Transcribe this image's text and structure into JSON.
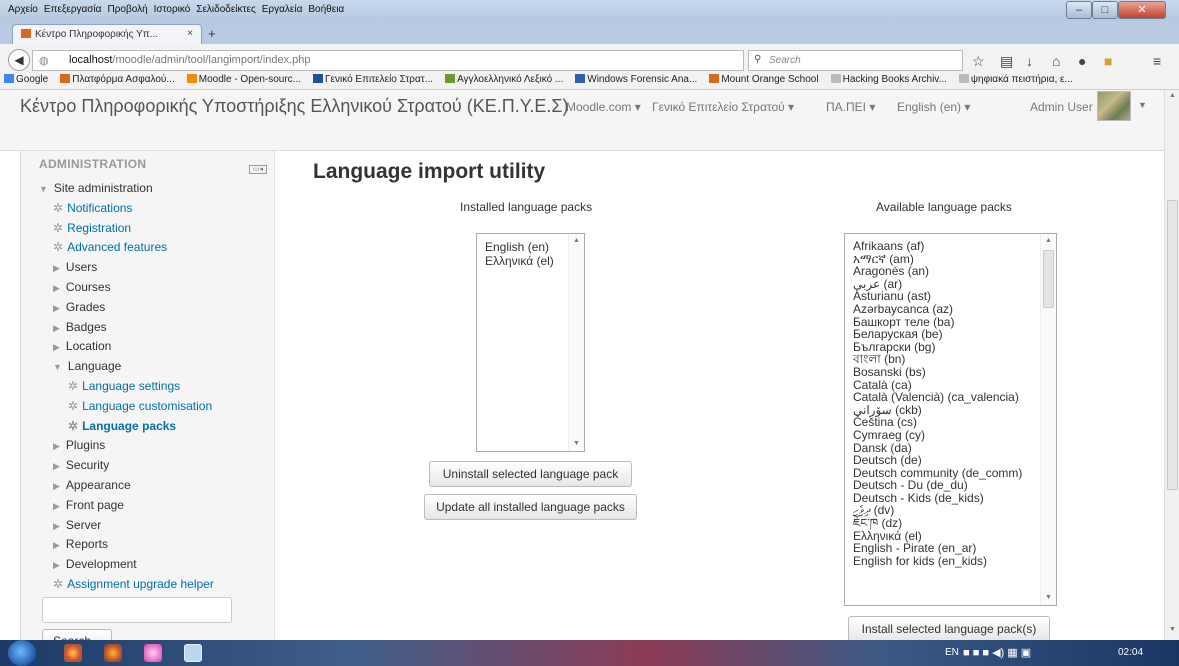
{
  "browser": {
    "menu": [
      "Αρχείο",
      "Επεξεργασία",
      "Προβολή",
      "Ιστορικό",
      "Σελιδοδείκτες",
      "Εργαλεία",
      "Βοήθεια"
    ],
    "tab_title": "Κέντρο Πληροφορικής Υπ...",
    "url_host": "localhost",
    "url_path": "/moodle/admin/tool/langimport/index.php",
    "search_placeholder": "Search",
    "bookmarks": [
      {
        "label": "Google",
        "color": "#4285f4"
      },
      {
        "label": "Πλατφόρμα Ασφαλού...",
        "color": "#d9681f"
      },
      {
        "label": "Moodle - Open-sourc...",
        "color": "#f38b00"
      },
      {
        "label": "Γενικό Επιτελείο Στρατ...",
        "color": "#1f4f9e"
      },
      {
        "label": "Αγγλοελληνικό Λεξικό ...",
        "color": "#6a9a2a"
      },
      {
        "label": "Windows Forensic Ana...",
        "color": "#2f5fa8"
      },
      {
        "label": "Mount Orange School",
        "color": "#d9681f"
      },
      {
        "label": "Hacking Books Archiv...",
        "color": "#bbbbbb"
      },
      {
        "label": "ψηφιακά πειστήρια, ε...",
        "color": "#bbbbbb"
      }
    ]
  },
  "header": {
    "site_title": "Κέντρο Πληροφορικής Υποστήριξης Ελληνικού Στρατού (ΚΕ.Π.Υ.Ε.Σ)",
    "menus": [
      "Moodle.com ▾",
      "Γενικό Επιτελείο Στρατού ▾",
      "ΠΑ.ΠΕΙ ▾",
      "English (en) ▾"
    ],
    "user": "Admin User"
  },
  "sidebar": {
    "block_title": "ADMINISTRATION",
    "items": [
      {
        "label": "Site administration",
        "kind": "open"
      },
      {
        "label": "Notifications",
        "kind": "gear"
      },
      {
        "label": "Registration",
        "kind": "gear"
      },
      {
        "label": "Advanced features",
        "kind": "gear"
      },
      {
        "label": "Users",
        "kind": "closed"
      },
      {
        "label": "Courses",
        "kind": "closed"
      },
      {
        "label": "Grades",
        "kind": "closed"
      },
      {
        "label": "Badges",
        "kind": "closed"
      },
      {
        "label": "Location",
        "kind": "closed"
      },
      {
        "label": "Language",
        "kind": "open"
      },
      {
        "label": "Language settings",
        "kind": "gear"
      },
      {
        "label": "Language customisation",
        "kind": "gear"
      },
      {
        "label": "Language packs",
        "kind": "active"
      },
      {
        "label": "Plugins",
        "kind": "closed"
      },
      {
        "label": "Security",
        "kind": "closed"
      },
      {
        "label": "Appearance",
        "kind": "closed"
      },
      {
        "label": "Front page",
        "kind": "closed"
      },
      {
        "label": "Server",
        "kind": "closed"
      },
      {
        "label": "Reports",
        "kind": "closed"
      },
      {
        "label": "Development",
        "kind": "closed"
      },
      {
        "label": "Assignment upgrade helper",
        "kind": "gear"
      }
    ],
    "search_button": "Search"
  },
  "main": {
    "title": "Language import utility",
    "installed_caption": "Installed language packs",
    "available_caption": "Available language packs",
    "installed": [
      "English (en)",
      "Ελληνικά (el)"
    ],
    "available": [
      "Afrikaans (af)",
      "አማርኛ (am)",
      "Aragonés (an)",
      "عربي (ar)",
      "Asturianu (ast)",
      "Azərbaycanca (az)",
      "Башкорт теле (ba)",
      "Беларуская (be)",
      "Български (bg)",
      "বাংলা (bn)",
      "Bosanski (bs)",
      "Català (ca)",
      "Català (Valencià) (ca_valencia)",
      "سۆرانی (ckb)",
      "Čeština (cs)",
      "Cymraeg (cy)",
      "Dansk (da)",
      "Deutsch (de)",
      "Deutsch community (de_comm)",
      "Deutsch - Du (de_du)",
      "Deutsch - Kids (de_kids)",
      "ދިވެހި (dv)",
      "ཇོང་ཁ (dz)",
      "Ελληνικά (el)",
      "English - Pirate (en_ar)",
      "English for kids (en_kids)"
    ],
    "uninstall_button": "Uninstall selected language pack",
    "update_button": "Update all installed language packs",
    "install_button": "Install selected language pack(s)"
  },
  "taskbar": {
    "lang": "EN",
    "time": "02:04"
  }
}
